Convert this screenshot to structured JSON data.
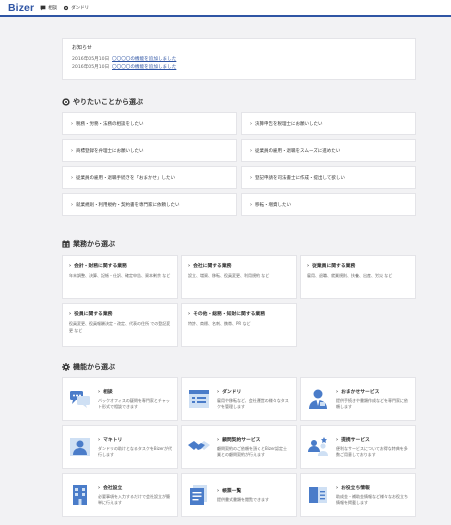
{
  "header": {
    "logo": "Bizer",
    "nav": [
      {
        "label": "相談",
        "icon": "chat-icon"
      },
      {
        "label": "ダンドリ",
        "icon": "gear-icon"
      }
    ]
  },
  "notice": {
    "title": "お知らせ",
    "items": [
      {
        "date": "2016年05月10日",
        "text": "〇〇〇〇の機能を追加しました"
      },
      {
        "date": "2016年05月10日",
        "text": "〇〇〇〇の機能を追加しました"
      }
    ]
  },
  "want_section": {
    "heading": "やりたいことから選ぶ",
    "items": [
      "税務・労務・法務の相談をしたい",
      "決算申告を税理士にお願いしたい",
      "商標登録を弁理士にお願いしたい",
      "従業員の雇用・退職をスムーズに進めたい",
      "従業員の雇用・退職手続きを「おまかせ」したい",
      "登記申請を司法書士に作成・提出して欲しい",
      "就業規則・利用規約・契約書を専門家に依頼したい",
      "移転・増資したい"
    ]
  },
  "business_section": {
    "heading": "業務から選ぶ",
    "cards": [
      {
        "title": "会計・財務に関する業務",
        "desc": "年末調整、決算、記帳・仕訳、確定申告、資本剰余 など"
      },
      {
        "title": "会社に関する業務",
        "desc": "設立、増資、移転、役員変更、利用規約 など"
      },
      {
        "title": "従業員に関する業務",
        "desc": "雇用、退職、就業規則、扶養、出産、労災 など"
      },
      {
        "title": "役員に関する業務",
        "desc": "役員変更、役員報酬決定・改定、代表の住所 での登記変更 など"
      },
      {
        "title": "その他・総務・知財に関する業務",
        "desc": "特許、商標、名刺、携帯、PR など"
      }
    ]
  },
  "feature_section": {
    "heading": "機能から選ぶ",
    "cards": [
      {
        "title": "相談",
        "desc": "バックオフィスの疑問を専門家とチャット形式で相談できます",
        "icon": "chat-bubbles-icon"
      },
      {
        "title": "ダンドリ",
        "desc": "雇用や移転など、会社運営の様々なタスクを管理します",
        "icon": "task-list-icon"
      },
      {
        "title": "おまかせサービス",
        "desc": "提供手続きや書類作成などを専門家に依頼します",
        "icon": "expert-person-icon"
      },
      {
        "title": "マキトリ",
        "desc": "ダンドリの助けとなるタスクをBizerが代行します",
        "icon": "assistant-person-icon"
      },
      {
        "title": "顧問契約サービス",
        "desc": "顧問契約のご依頼を頂くとBizer認定士業との顧問契約が行えます",
        "icon": "handshake-icon"
      },
      {
        "title": "提携サービス",
        "desc": "便利なサービスについてお得な特典を多数ご用意しております",
        "icon": "partner-network-icon"
      },
      {
        "title": "会社設立",
        "desc": "必要事項を入力するだけで会社設立が簡単に行えます",
        "icon": "building-icon"
      },
      {
        "title": "帳票一覧",
        "desc": "提供書式書類を閲覧できます",
        "icon": "documents-icon"
      },
      {
        "title": "お役立ち情報",
        "desc": "助成金・補助金情報など様々なお役立ち情報を掲載します",
        "icon": "info-book-icon"
      }
    ]
  },
  "colors": {
    "brand": "#2f55a4",
    "icon_blue": "#4a7cc9",
    "icon_light": "#cfe0f4",
    "background": "#f2f2f4"
  }
}
